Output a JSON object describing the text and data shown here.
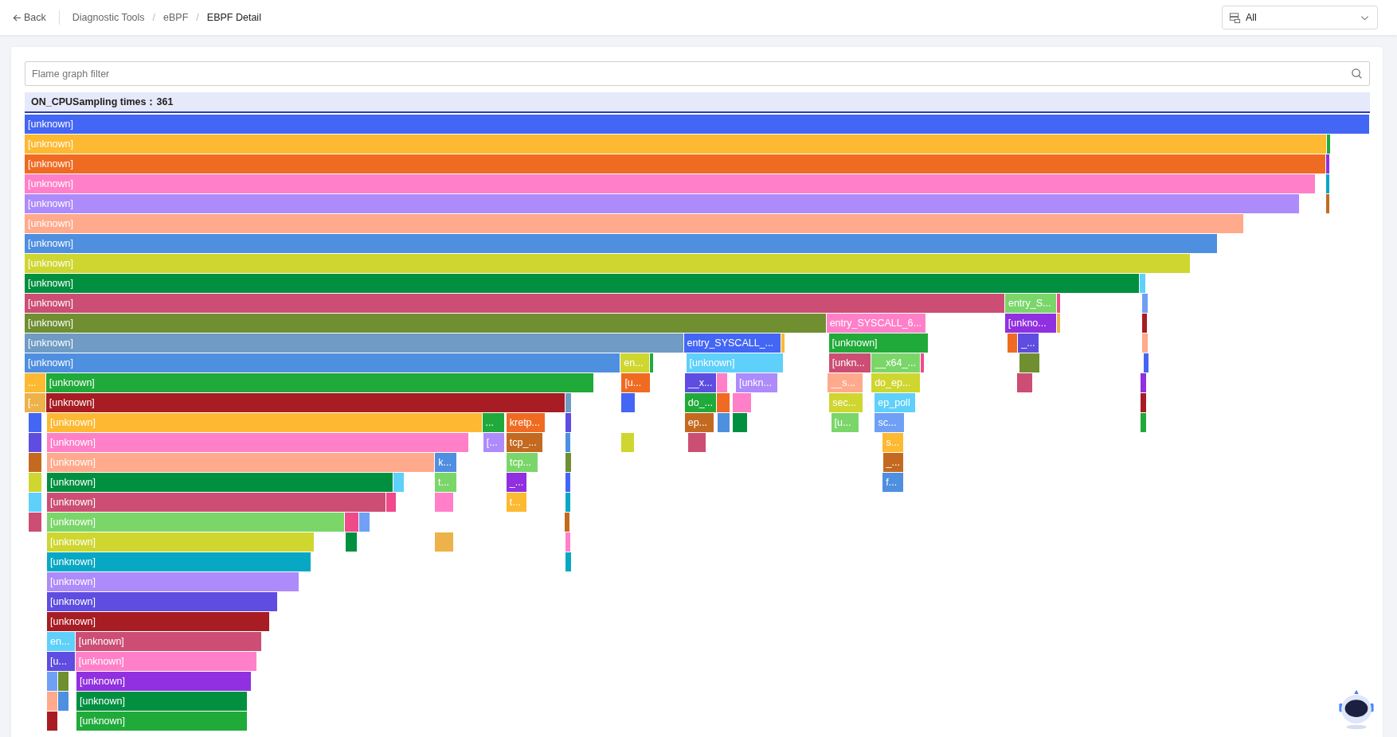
{
  "header": {
    "back": {
      "label": "Back"
    },
    "breadcrumbs": [
      {
        "label": "Diagnostic Tools",
        "separator": "/",
        "selected": false
      },
      {
        "label": "eBPF",
        "separator": "/",
        "selected": false
      },
      {
        "label": "EBPF Detail",
        "selected": true
      }
    ],
    "view_select": {
      "value": "All"
    }
  },
  "filter": {
    "placeholder": "Flame graph filter"
  },
  "flame_graph": {
    "title": "ON_CPUSampling times：361",
    "rows": [
      {
        "frames": [
          {
            "label": "[unknown]",
            "color": "#4466f5"
          }
        ]
      },
      {
        "frames": [
          {
            "label": "[unknown]",
            "color": "#fdb932"
          },
          {
            "color": "#20aa3a"
          }
        ]
      },
      {
        "frames": [
          {
            "label": "[unknown]",
            "color": "#f06b22"
          },
          {
            "color": "#9030e0"
          }
        ]
      },
      {
        "frames": [
          {
            "label": "[unknown]",
            "color": "#ff80c8"
          },
          {
            "color": "#08a8c4"
          }
        ]
      },
      {
        "frames": [
          {
            "label": "[unknown]",
            "color": "#ae8bfa"
          },
          {
            "color": "#c46a20"
          }
        ]
      },
      {
        "frames": [
          {
            "label": "[unknown]",
            "color": "#ffaa8c"
          }
        ]
      },
      {
        "frames": [
          {
            "label": "[unknown]",
            "color": "#4f8fe0"
          }
        ]
      },
      {
        "frames": [
          {
            "label": "[unknown]",
            "color": "#cfd630"
          }
        ]
      },
      {
        "frames": [
          {
            "label": "[unknown]",
            "color": "#009040"
          },
          {
            "color": "#5fd0fa"
          }
        ]
      },
      {
        "frames": [
          {
            "label": "[unknown]",
            "color": "#cc4e74"
          },
          {
            "label": "entry_S...",
            "color": "#7bd66a"
          },
          {
            "color": "#f04a8a"
          },
          {
            "color": "#6fa0f5"
          }
        ]
      },
      {
        "frames": [
          {
            "label": "[unknown]",
            "color": "#6f8f30"
          },
          {
            "label": "entry_SYSCALL_6...",
            "color": "#ff80c8"
          },
          {
            "label": "[unkno...",
            "color": "#9030e0"
          },
          {
            "color": "#eeb24a"
          },
          {
            "color": "#a81c24"
          }
        ]
      },
      {
        "frames": [
          {
            "label": "[unknown]",
            "color": "#6f9bc5"
          },
          {
            "label": "entry_SYSCALL_...",
            "color": "#4466f5"
          },
          {
            "color": "#fdb932"
          },
          {
            "label": "[unknown]",
            "color": "#20aa3a"
          },
          {
            "color": "#f06b22"
          },
          {
            "label": "_...",
            "color": "#5e4de0"
          },
          {
            "color": "#ffaa8c"
          }
        ]
      },
      {
        "frames": [
          {
            "label": "[unknown]",
            "color": "#4f8fe0"
          },
          {
            "label": "en...",
            "color": "#cfd630"
          },
          {
            "color": "#20aa3a"
          },
          {
            "label": "[unknown]",
            "color": "#5fd0fa"
          },
          {
            "label": "[unkn...",
            "color": "#cc4e74"
          },
          {
            "label": "__x64_...",
            "color": "#7bd66a"
          },
          {
            "color": "#f04a8a"
          },
          {
            "color": "#6f8f30"
          },
          {
            "color": "#4466f5"
          }
        ]
      },
      {
        "frames": [
          {
            "label": "...",
            "color": "#fdb932"
          },
          {
            "label": "[unknown]",
            "color": "#20aa3a"
          },
          {
            "label": "[u...",
            "color": "#f06b22"
          },
          {
            "label": "__x...",
            "color": "#5e4de0"
          },
          {
            "color": "#ff80c8"
          },
          {
            "label": "[unkn...",
            "color": "#ae8bfa"
          },
          {
            "label": "__s...",
            "color": "#ffaa8c"
          },
          {
            "label": "do_ep...",
            "color": "#cfd630"
          },
          {
            "color": "#cc4e74"
          },
          {
            "color": "#9030e0"
          }
        ]
      },
      {
        "frames": [
          {
            "label": "[...",
            "color": "#eeb24a"
          },
          {
            "label": "[unknown]",
            "color": "#a81c24"
          },
          {
            "color": "#6f9bc5"
          },
          {
            "color": "#4466f5"
          },
          {
            "label": "do_...",
            "color": "#20aa3a"
          },
          {
            "color": "#f06b22"
          },
          {
            "color": "#ff80c8"
          },
          {
            "label": "sec...",
            "color": "#cfd630"
          },
          {
            "label": "ep_poll",
            "color": "#5fd0fa"
          },
          {
            "color": "#a81c24"
          }
        ]
      },
      {
        "frames": [
          {
            "color": "#4466f5"
          },
          {
            "label": "[unknown]",
            "color": "#fdb932"
          },
          {
            "label": "...",
            "color": "#20aa3a"
          },
          {
            "label": "kretp...",
            "color": "#f06b22"
          },
          {
            "color": "#5e4de0"
          },
          {
            "label": "ep...",
            "color": "#c46a20"
          },
          {
            "color": "#4f8fe0"
          },
          {
            "color": "#009040"
          },
          {
            "label": "[u...",
            "color": "#7bd66a"
          },
          {
            "label": "sc...",
            "color": "#6fa0f5"
          },
          {
            "color": "#20aa3a"
          }
        ]
      },
      {
        "frames": [
          {
            "color": "#5e4de0"
          },
          {
            "label": "[unknown]",
            "color": "#ff80c8"
          },
          {
            "label": "[...",
            "color": "#ae8bfa"
          },
          {
            "label": "tcp_...",
            "color": "#c46a20"
          },
          {
            "color": "#4f8fe0"
          },
          {
            "color": "#cfd630"
          },
          {
            "color": "#cc4e74"
          },
          {
            "label": "s...",
            "color": "#fdb932"
          }
        ]
      },
      {
        "frames": [
          {
            "color": "#c46a20"
          },
          {
            "label": "[unknown]",
            "color": "#ffaa8c"
          },
          {
            "label": "k...",
            "color": "#4f8fe0"
          },
          {
            "label": "tcp...",
            "color": "#7bd66a"
          },
          {
            "color": "#6f8f30"
          },
          {
            "label": "_...",
            "color": "#c46a20"
          }
        ]
      },
      {
        "frames": [
          {
            "color": "#cfd630"
          },
          {
            "label": "[unknown]",
            "color": "#009040"
          },
          {
            "color": "#5fd0fa"
          },
          {
            "label": "t...",
            "color": "#7bd66a"
          },
          {
            "label": "_...",
            "color": "#9030e0"
          },
          {
            "color": "#4466f5"
          },
          {
            "label": "f...",
            "color": "#4f8fe0"
          }
        ]
      },
      {
        "frames": [
          {
            "color": "#5fd0fa"
          },
          {
            "label": "[unknown]",
            "color": "#cc4e74"
          },
          {
            "color": "#f04a8a"
          },
          {
            "color": "#ff80c8"
          },
          {
            "label": "t...",
            "color": "#fdb932"
          },
          {
            "color": "#08a8c4"
          }
        ]
      },
      {
        "frames": [
          {
            "color": "#cc4e74"
          },
          {
            "label": "[unknown]",
            "color": "#7bd66a"
          },
          {
            "color": "#f04a8a"
          },
          {
            "color": "#6fa0f5"
          },
          {
            "color": "#c46a20"
          }
        ]
      },
      {
        "frames": [
          {
            "label": "[unknown]",
            "color": "#cfd630"
          },
          {
            "color": "#009040"
          },
          {
            "color": "#eeb24a"
          },
          {
            "color": "#ff80c8"
          }
        ]
      },
      {
        "frames": [
          {
            "label": "[unknown]",
            "color": "#08a8c4"
          },
          {
            "color": "#08a8c4"
          }
        ]
      },
      {
        "frames": [
          {
            "label": "[unknown]",
            "color": "#ae8bfa"
          }
        ]
      },
      {
        "frames": [
          {
            "label": "[unknown]",
            "color": "#5e4de0"
          }
        ]
      },
      {
        "frames": [
          {
            "label": "[unknown]",
            "color": "#a81c24"
          }
        ]
      },
      {
        "frames": [
          {
            "label": "en...",
            "color": "#5fd0fa"
          },
          {
            "label": "[unknown]",
            "color": "#cc4e74"
          }
        ]
      },
      {
        "frames": [
          {
            "label": "[u...",
            "color": "#5e4de0"
          },
          {
            "label": "[unknown]",
            "color": "#ff80c8"
          }
        ]
      },
      {
        "frames": [
          {
            "color": "#6fa0f5"
          },
          {
            "color": "#6f8f30"
          },
          {
            "label": "[unknown]",
            "color": "#9030e0"
          }
        ]
      },
      {
        "frames": [
          {
            "color": "#ffaa8c"
          },
          {
            "color": "#4f8fe0"
          },
          {
            "label": "[unknown]",
            "color": "#009040"
          }
        ]
      },
      {
        "frames": [
          {
            "color": "#a81c24"
          },
          {
            "label": "[unknown]",
            "color": "#20aa3a"
          }
        ]
      }
    ]
  }
}
